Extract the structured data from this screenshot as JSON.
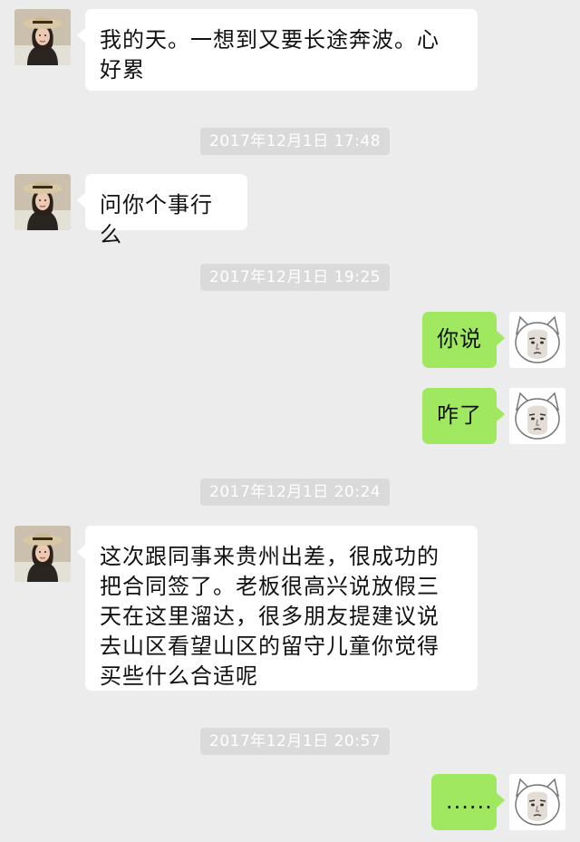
{
  "messages": [
    {
      "text": "我的天。一想到又要长途奔波。心好累"
    },
    {
      "text": "问你个事行么"
    },
    {
      "text": "你说"
    },
    {
      "text": "咋了"
    },
    {
      "text": "这次跟同事来贵州出差，很成功的把合同签了。老板很高兴说放假三天在这里溜达，很多朋友提建议说去山区看望山区的留守儿童你觉得买些什么合适呢"
    },
    {
      "text": "......"
    }
  ],
  "timestamps": [
    "2017年12月1日 17:48",
    "2017年12月1日 19:25",
    "2017年12月1日 20:24",
    "2017年12月1日 20:57"
  ],
  "colors": {
    "background": "#ececec",
    "incoming_bubble": "#ffffff",
    "outgoing_bubble": "#9fe85f",
    "timestamp_pill": "#dadada"
  },
  "icons": {
    "contact_avatar": "woman-with-hat-avatar-icon",
    "self_avatar": "cartoon-cat-face-avatar-icon"
  }
}
